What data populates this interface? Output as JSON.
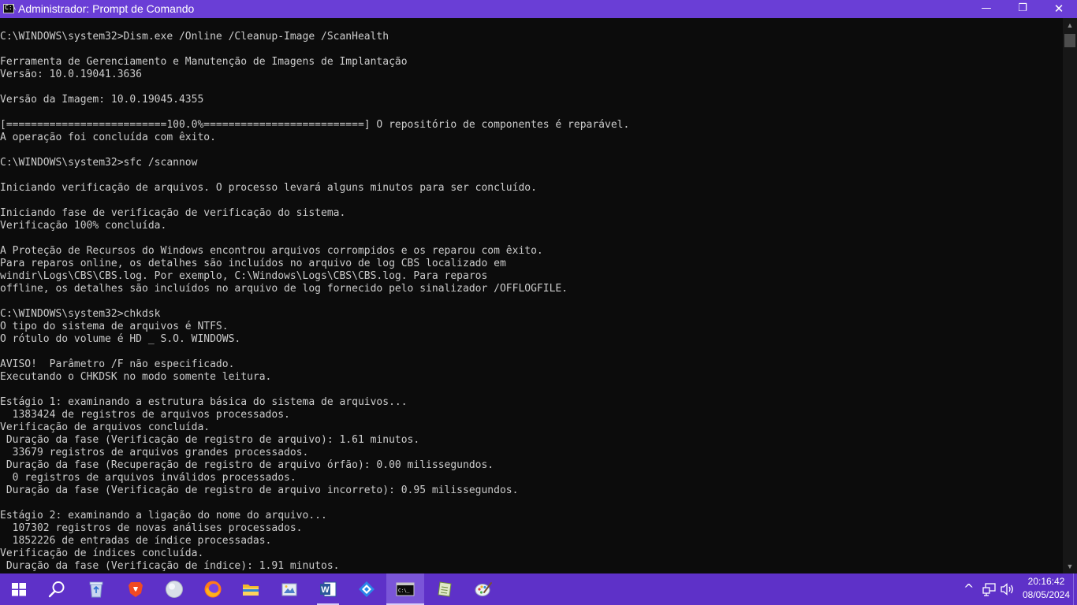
{
  "window": {
    "title": "Administrador: Prompt de Comando",
    "icon": "cmd-icon",
    "icon_glyph": "C:\\",
    "minimize_glyph": "—",
    "maximize_glyph": "❐",
    "close_glyph": "✕",
    "title_bar_color": "#6a3ed6"
  },
  "console": {
    "background": "#0c0c0c",
    "foreground": "#cccccc",
    "lines": [
      "C:\\WINDOWS\\system32>Dism.exe /Online /Cleanup-Image /ScanHealth",
      "",
      "Ferramenta de Gerenciamento e Manutenção de Imagens de Implantação",
      "Versão: 10.0.19041.3636",
      "",
      "Versão da Imagem: 10.0.19045.4355",
      "",
      "[==========================100.0%==========================] O repositório de componentes é reparável.",
      "A operação foi concluída com êxito.",
      "",
      "C:\\WINDOWS\\system32>sfc /scannow",
      "",
      "Iniciando verificação de arquivos. O processo levará alguns minutos para ser concluído.",
      "",
      "Iniciando fase de verificação de verificação do sistema.",
      "Verificação 100% concluída.",
      "",
      "A Proteção de Recursos do Windows encontrou arquivos corrompidos e os reparou com êxito.",
      "Para reparos online, os detalhes são incluídos no arquivo de log CBS localizado em",
      "windir\\Logs\\CBS\\CBS.log. Por exemplo, C:\\Windows\\Logs\\CBS\\CBS.log. Para reparos",
      "offline, os detalhes são incluídos no arquivo de log fornecido pelo sinalizador /OFFLOGFILE.",
      "",
      "C:\\WINDOWS\\system32>chkdsk",
      "O tipo do sistema de arquivos é NTFS.",
      "O rótulo do volume é HD _ S.O. WINDOWS.",
      "",
      "AVISO!  Parâmetro /F não especificado.",
      "Executando o CHKDSK no modo somente leitura.",
      "",
      "Estágio 1: examinando a estrutura básica do sistema de arquivos...",
      "  1383424 de registros de arquivos processados.",
      "Verificação de arquivos concluída.",
      " Duração da fase (Verificação de registro de arquivo): 1.61 minutos.",
      "  33679 registros de arquivos grandes processados.",
      " Duração da fase (Recuperação de registro de arquivo órfão): 0.00 milissegundos.",
      "  0 registros de arquivos inválidos processados.",
      " Duração da fase (Verificação de registro de arquivo incorreto): 0.95 milissegundos.",
      "",
      "Estágio 2: examinando a ligação do nome do arquivo...",
      "  107302 registros de novas análises processados.",
      "  1852226 de entradas de índice processadas.",
      "Verificação de índices concluída.",
      " Duração da fase (Verificação de índice): 1.91 minutos."
    ]
  },
  "scrollbar": {
    "up_glyph": "▲",
    "down_glyph": "▼"
  },
  "taskbar": {
    "color": "#5e31c8",
    "items": [
      {
        "name": "start-button-windows-icon",
        "state": ""
      },
      {
        "name": "search-icon",
        "state": ""
      },
      {
        "name": "recycle-bin-icon",
        "state": ""
      },
      {
        "name": "brave-browser-icon",
        "state": ""
      },
      {
        "name": "circle-app-icon",
        "state": ""
      },
      {
        "name": "firefox-icon",
        "state": ""
      },
      {
        "name": "file-explorer-icon",
        "state": ""
      },
      {
        "name": "photo-viewer-icon",
        "state": ""
      },
      {
        "name": "word-icon",
        "state": "open"
      },
      {
        "name": "shield-app-icon",
        "state": ""
      },
      {
        "name": "command-prompt-icon",
        "state": "active"
      },
      {
        "name": "notepad-app-icon",
        "state": ""
      },
      {
        "name": "paint-app-icon",
        "state": ""
      }
    ],
    "word_letter": "W",
    "cmd_glyph": "C:\\_"
  },
  "tray": {
    "chevron": "^",
    "network_icon": "network-icon",
    "volume_icon": "volume-icon"
  },
  "clock": {
    "time": "20:16:42",
    "date": "08/05/2024"
  }
}
